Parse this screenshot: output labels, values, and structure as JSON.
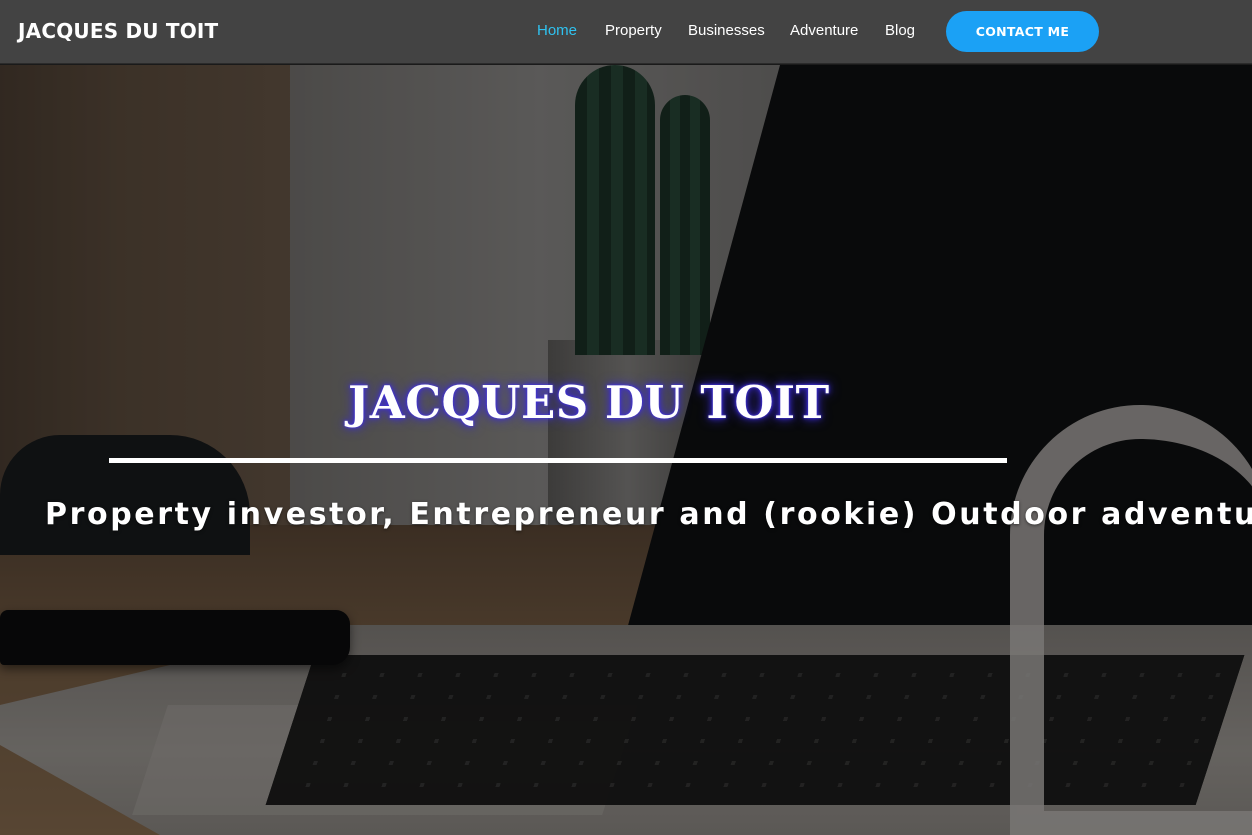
{
  "header": {
    "brand": "JACQUES DU TOIT",
    "nav": [
      {
        "label": "Home",
        "active": true
      },
      {
        "label": "Property",
        "active": false
      },
      {
        "label": "Businesses",
        "active": false
      },
      {
        "label": "Adventure",
        "active": false
      },
      {
        "label": "Blog",
        "active": false
      }
    ],
    "cta_label": "CONTACT ME"
  },
  "hero": {
    "title": "JACQUES DU TOIT",
    "subtitle": "Property investor, Entrepreneur and (rookie) Outdoor adventurer"
  },
  "colors": {
    "header_bg": "#434343",
    "nav_active": "#2fc2f0",
    "cta_bg": "#1ba1f5",
    "title_glow": "#3b2bd6"
  }
}
